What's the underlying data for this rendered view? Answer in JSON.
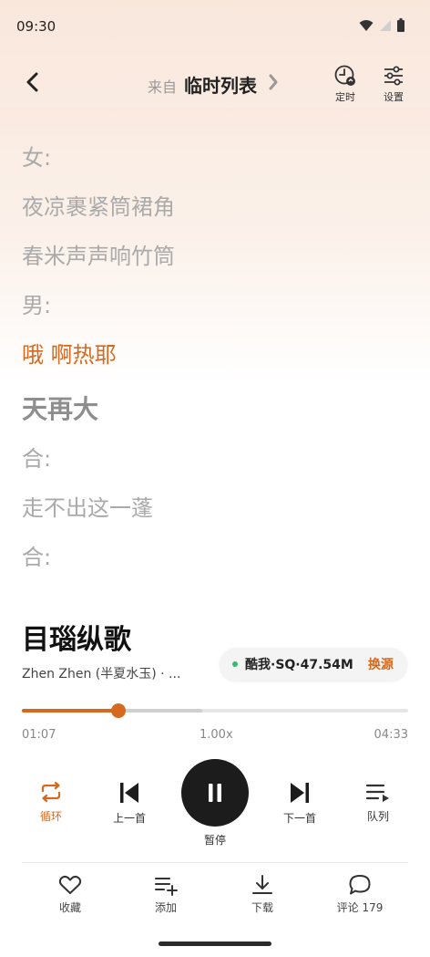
{
  "status_bar": {
    "time": "09:30"
  },
  "header": {
    "source_prefix": "来自",
    "source_name": "临时列表",
    "timer_label": "定时",
    "settings_label": "设置"
  },
  "lyrics": {
    "lines": [
      {
        "text": "女:",
        "state": "normal"
      },
      {
        "text": "夜凉裹紧筒裙角",
        "state": "normal"
      },
      {
        "text": "春米声声响竹筒",
        "state": "normal"
      },
      {
        "text": "男:",
        "state": "normal"
      },
      {
        "text": "哦 啊热耶",
        "state": "active"
      },
      {
        "text": "天再大",
        "state": "highlight"
      },
      {
        "text": "合:",
        "state": "normal"
      },
      {
        "text": "走不出这一蓬",
        "state": "normal"
      },
      {
        "text": "合:",
        "state": "normal"
      }
    ]
  },
  "song": {
    "title": "目瑙纵歌",
    "artist": "Zhen Zhen (半夏水玉) · ..."
  },
  "quality": {
    "text": "酷我·SQ·47.54M",
    "switch_label": "换源"
  },
  "progress": {
    "current": "01:07",
    "total": "04:33",
    "speed": "1.00x",
    "played_fraction": 0.25,
    "buffered_fraction": 0.466
  },
  "controls": {
    "loop_label": "循环",
    "prev_label": "上一首",
    "pause_label": "暂停",
    "next_label": "下一首",
    "queue_label": "队列"
  },
  "actions": {
    "favorite_label": "收藏",
    "add_label": "添加",
    "download_label": "下载",
    "comment_label": "评论 179"
  },
  "colors": {
    "accent": "#d7681f",
    "dark": "#1c1c1c",
    "quality_dot": "#2fbf71"
  }
}
